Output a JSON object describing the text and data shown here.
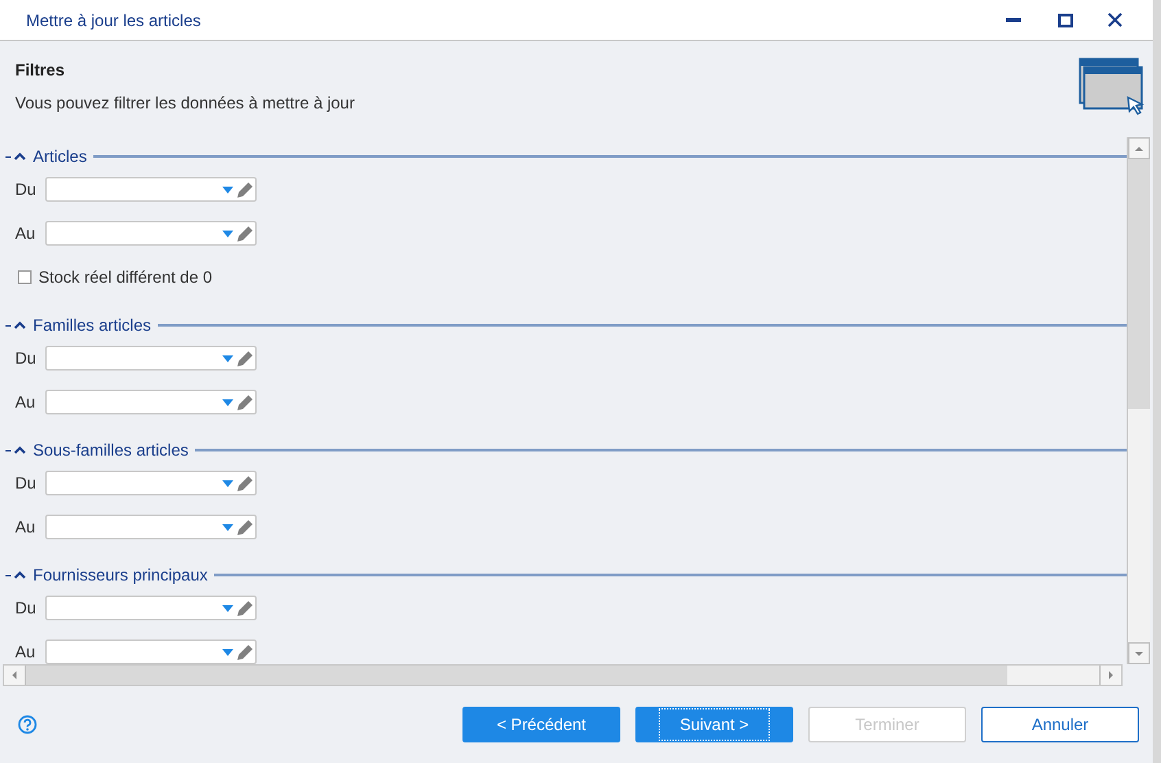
{
  "window": {
    "title": "Mettre à jour les articles"
  },
  "header": {
    "title": "Filtres",
    "subtitle": "Vous pouvez filtrer les données à mettre à jour"
  },
  "sections": [
    {
      "label": "Articles",
      "expanded": true,
      "rows": [
        {
          "kind": "range",
          "label": "Du"
        },
        {
          "kind": "range",
          "label": "Au"
        },
        {
          "kind": "checkbox",
          "label": "Stock réel différent de 0",
          "checked": false
        }
      ]
    },
    {
      "label": "Familles articles",
      "expanded": true,
      "rows": [
        {
          "kind": "range",
          "label": "Du"
        },
        {
          "kind": "range",
          "label": "Au"
        }
      ]
    },
    {
      "label": "Sous-familles articles",
      "expanded": true,
      "rows": [
        {
          "kind": "range",
          "label": "Du"
        },
        {
          "kind": "range",
          "label": "Au"
        }
      ]
    },
    {
      "label": "Fournisseurs principaux",
      "expanded": true,
      "rows": [
        {
          "kind": "range",
          "label": "Du"
        },
        {
          "kind": "range",
          "label": "Au"
        }
      ]
    }
  ],
  "buttons": [
    {
      "label": "< Précédent",
      "kind": "primary",
      "focused": false
    },
    {
      "label": "Suivant >",
      "kind": "primary",
      "focused": true
    },
    {
      "label": "Terminer",
      "kind": "disabled",
      "focused": false
    },
    {
      "label": "Annuler",
      "kind": "outline",
      "focused": false
    }
  ]
}
